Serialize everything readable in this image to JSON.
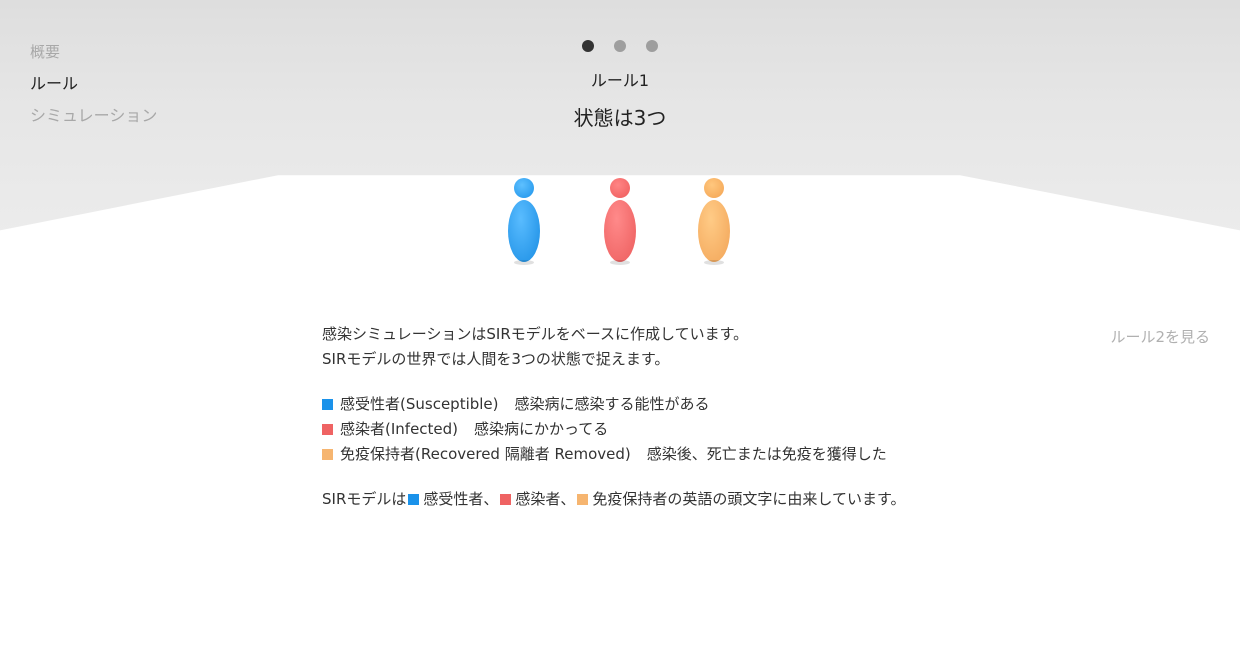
{
  "nav": {
    "items": [
      {
        "label": "概要",
        "active": false
      },
      {
        "label": "ルール",
        "active": true
      },
      {
        "label": "シミュレーション",
        "active": false
      }
    ]
  },
  "pager": {
    "count": 3,
    "active_index": 0
  },
  "rule": {
    "label": "ルール1",
    "title": "状態は3つ"
  },
  "figures": [
    {
      "name": "susceptible",
      "color": "#1a92ea"
    },
    {
      "name": "infected",
      "color": "#ef6363"
    },
    {
      "name": "recovered",
      "color": "#f6b570"
    }
  ],
  "content": {
    "intro_line1": "感染シミュレーションはSIRモデルをベースに作成しています。",
    "intro_line2": "SIRモデルの世界では人間を3つの状態で捉えます。",
    "legend": [
      {
        "term": "感受性者(Susceptible)",
        "desc": "感染病に感染する能性がある",
        "color": "#1a92ea"
      },
      {
        "term": "感染者(Infected)",
        "desc": "感染病にかかってる",
        "color": "#ef6363"
      },
      {
        "term": "免疫保持者(Recovered 隔離者 Removed)",
        "desc": "感染後、死亡または免疫を獲得した",
        "color": "#f6b570"
      }
    ],
    "summary_prefix": "SIRモデルは",
    "summary_s": "感受性者、",
    "summary_i": "感染者、",
    "summary_r": "免疫保持者の英語の頭文字に由来しています。"
  },
  "next_link": "ルール2を見る"
}
